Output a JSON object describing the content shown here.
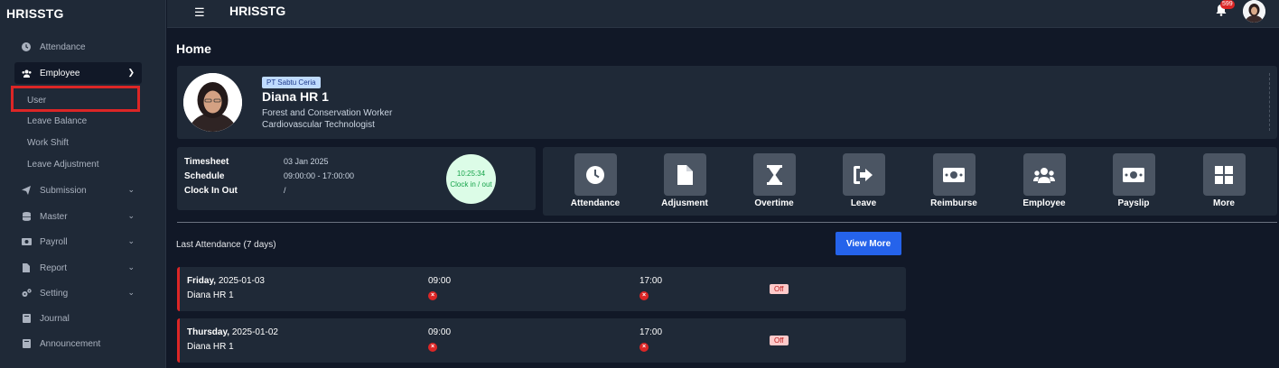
{
  "app": {
    "brand": "HRISSTG",
    "top_title": "HRISSTG",
    "notif_count": "599"
  },
  "sidebar": {
    "items": [
      {
        "label": "Attendance",
        "icon": "clock-icon"
      },
      {
        "label": "Employee",
        "icon": "users-icon"
      },
      {
        "label": "Submission",
        "icon": "paper-plane-icon"
      },
      {
        "label": "Master",
        "icon": "database-icon"
      },
      {
        "label": "Payroll",
        "icon": "money-icon"
      },
      {
        "label": "Report",
        "icon": "file-icon"
      },
      {
        "label": "Setting",
        "icon": "gears-icon"
      },
      {
        "label": "Journal",
        "icon": "book-icon"
      },
      {
        "label": "Announcement",
        "icon": "book-icon"
      }
    ],
    "employee_sub": [
      "User",
      "Leave Balance",
      "Work Shift",
      "Leave Adjustment"
    ]
  },
  "page": {
    "title": "Home"
  },
  "profile": {
    "company": "PT Sabtu Ceria",
    "name": "Diana HR 1",
    "title1": "Forest and Conservation Worker",
    "title2": "Cardiovascular Technologist"
  },
  "timesheet": {
    "labels": [
      "Timesheet",
      "Schedule",
      "Clock In Out"
    ],
    "values": [
      "03 Jan 2025",
      "09:00:00 - 17:00:00",
      "/"
    ],
    "clock_time": "10:25:34",
    "clock_label": "Clock in / out"
  },
  "shortcuts": [
    {
      "label": "Attendance",
      "icon": "clock-icon"
    },
    {
      "label": "Adjusment",
      "icon": "file-icon"
    },
    {
      "label": "Overtime",
      "icon": "hourglass-icon"
    },
    {
      "label": "Leave",
      "icon": "sign-out-icon"
    },
    {
      "label": "Reimburse",
      "icon": "money-icon"
    },
    {
      "label": "Employee",
      "icon": "users-icon"
    },
    {
      "label": "Payslip",
      "icon": "money-icon"
    },
    {
      "label": "More",
      "icon": "grid-icon"
    }
  ],
  "last_attendance": {
    "heading": "Last Attendance (7 days)",
    "view_more": "View More",
    "rows": [
      {
        "day": "Friday,",
        "date": " 2025-01-03",
        "name": "Diana HR 1",
        "in": "09:00",
        "out": "17:00",
        "status": "Off"
      },
      {
        "day": "Thursday,",
        "date": " 2025-01-02",
        "name": "Diana HR 1",
        "in": "09:00",
        "out": "17:00",
        "status": "Off"
      }
    ]
  }
}
